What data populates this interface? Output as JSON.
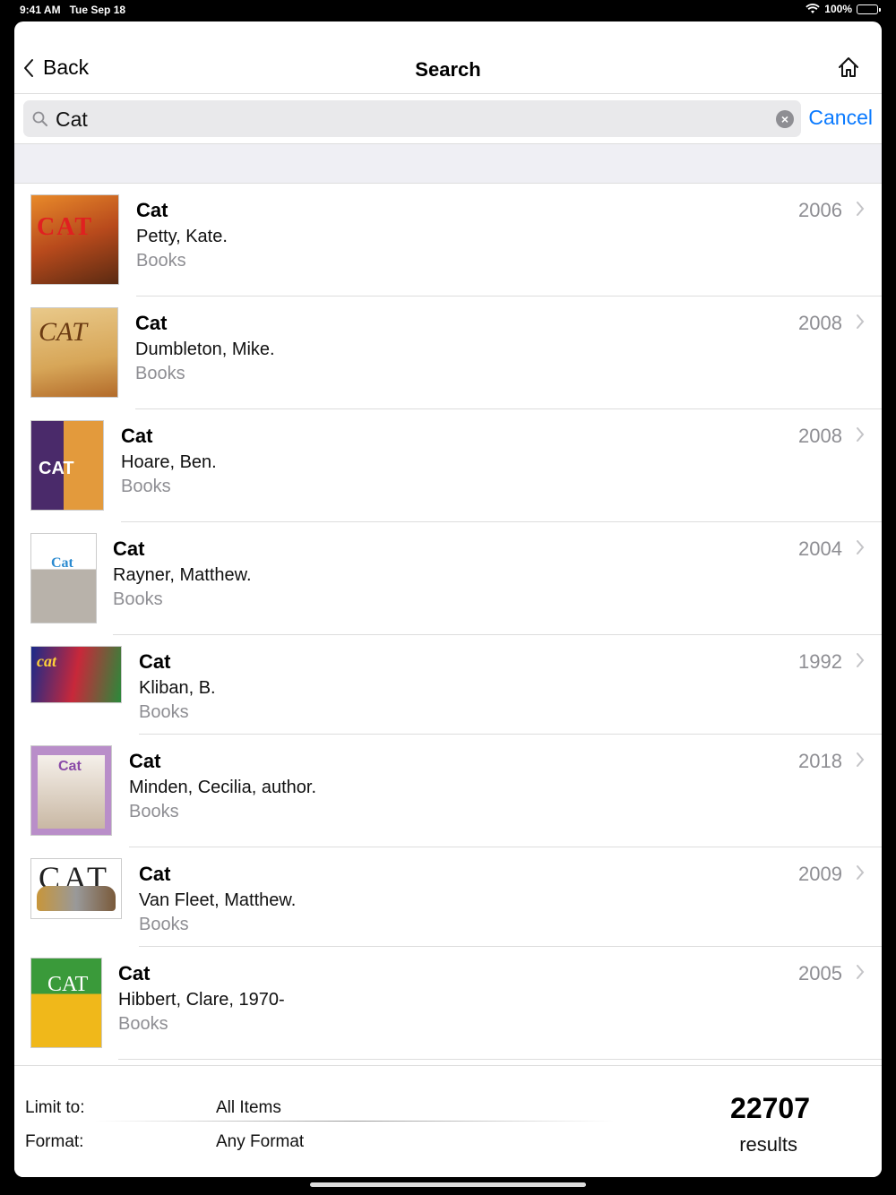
{
  "status": {
    "time": "9:41 AM",
    "date": "Tue Sep 18",
    "battery": "100%"
  },
  "nav": {
    "back_label": "Back",
    "title": "Search",
    "home_icon": "home-icon"
  },
  "search": {
    "value": "Cat",
    "cancel_label": "Cancel"
  },
  "results": [
    {
      "title": "Cat",
      "author": "Petty, Kate.",
      "format": "Books",
      "year": "2006"
    },
    {
      "title": "Cat",
      "author": "Dumbleton, Mike.",
      "format": "Books",
      "year": "2008"
    },
    {
      "title": "Cat",
      "author": "Hoare, Ben.",
      "format": "Books",
      "year": "2008"
    },
    {
      "title": "Cat",
      "author": "Rayner, Matthew.",
      "format": "Books",
      "year": "2004"
    },
    {
      "title": "Cat",
      "author": "Kliban, B.",
      "format": "Books",
      "year": "1992"
    },
    {
      "title": "Cat",
      "author": "Minden, Cecilia, author.",
      "format": "Books",
      "year": "2018"
    },
    {
      "title": "Cat",
      "author": "Van Fleet, Matthew.",
      "format": "Books",
      "year": "2009"
    },
    {
      "title": "Cat",
      "author": "Hibbert, Clare, 1970-",
      "format": "Books",
      "year": "2005"
    }
  ],
  "covers": [
    "CAT",
    "CAT",
    "CAT",
    "Cat",
    "cat",
    "Cat",
    "CAT",
    "CAT"
  ],
  "footer": {
    "limit_label": "Limit to:",
    "limit_value": "All Items",
    "format_label": "Format:",
    "format_value": "Any Format",
    "count": "22707",
    "count_label": "results"
  }
}
